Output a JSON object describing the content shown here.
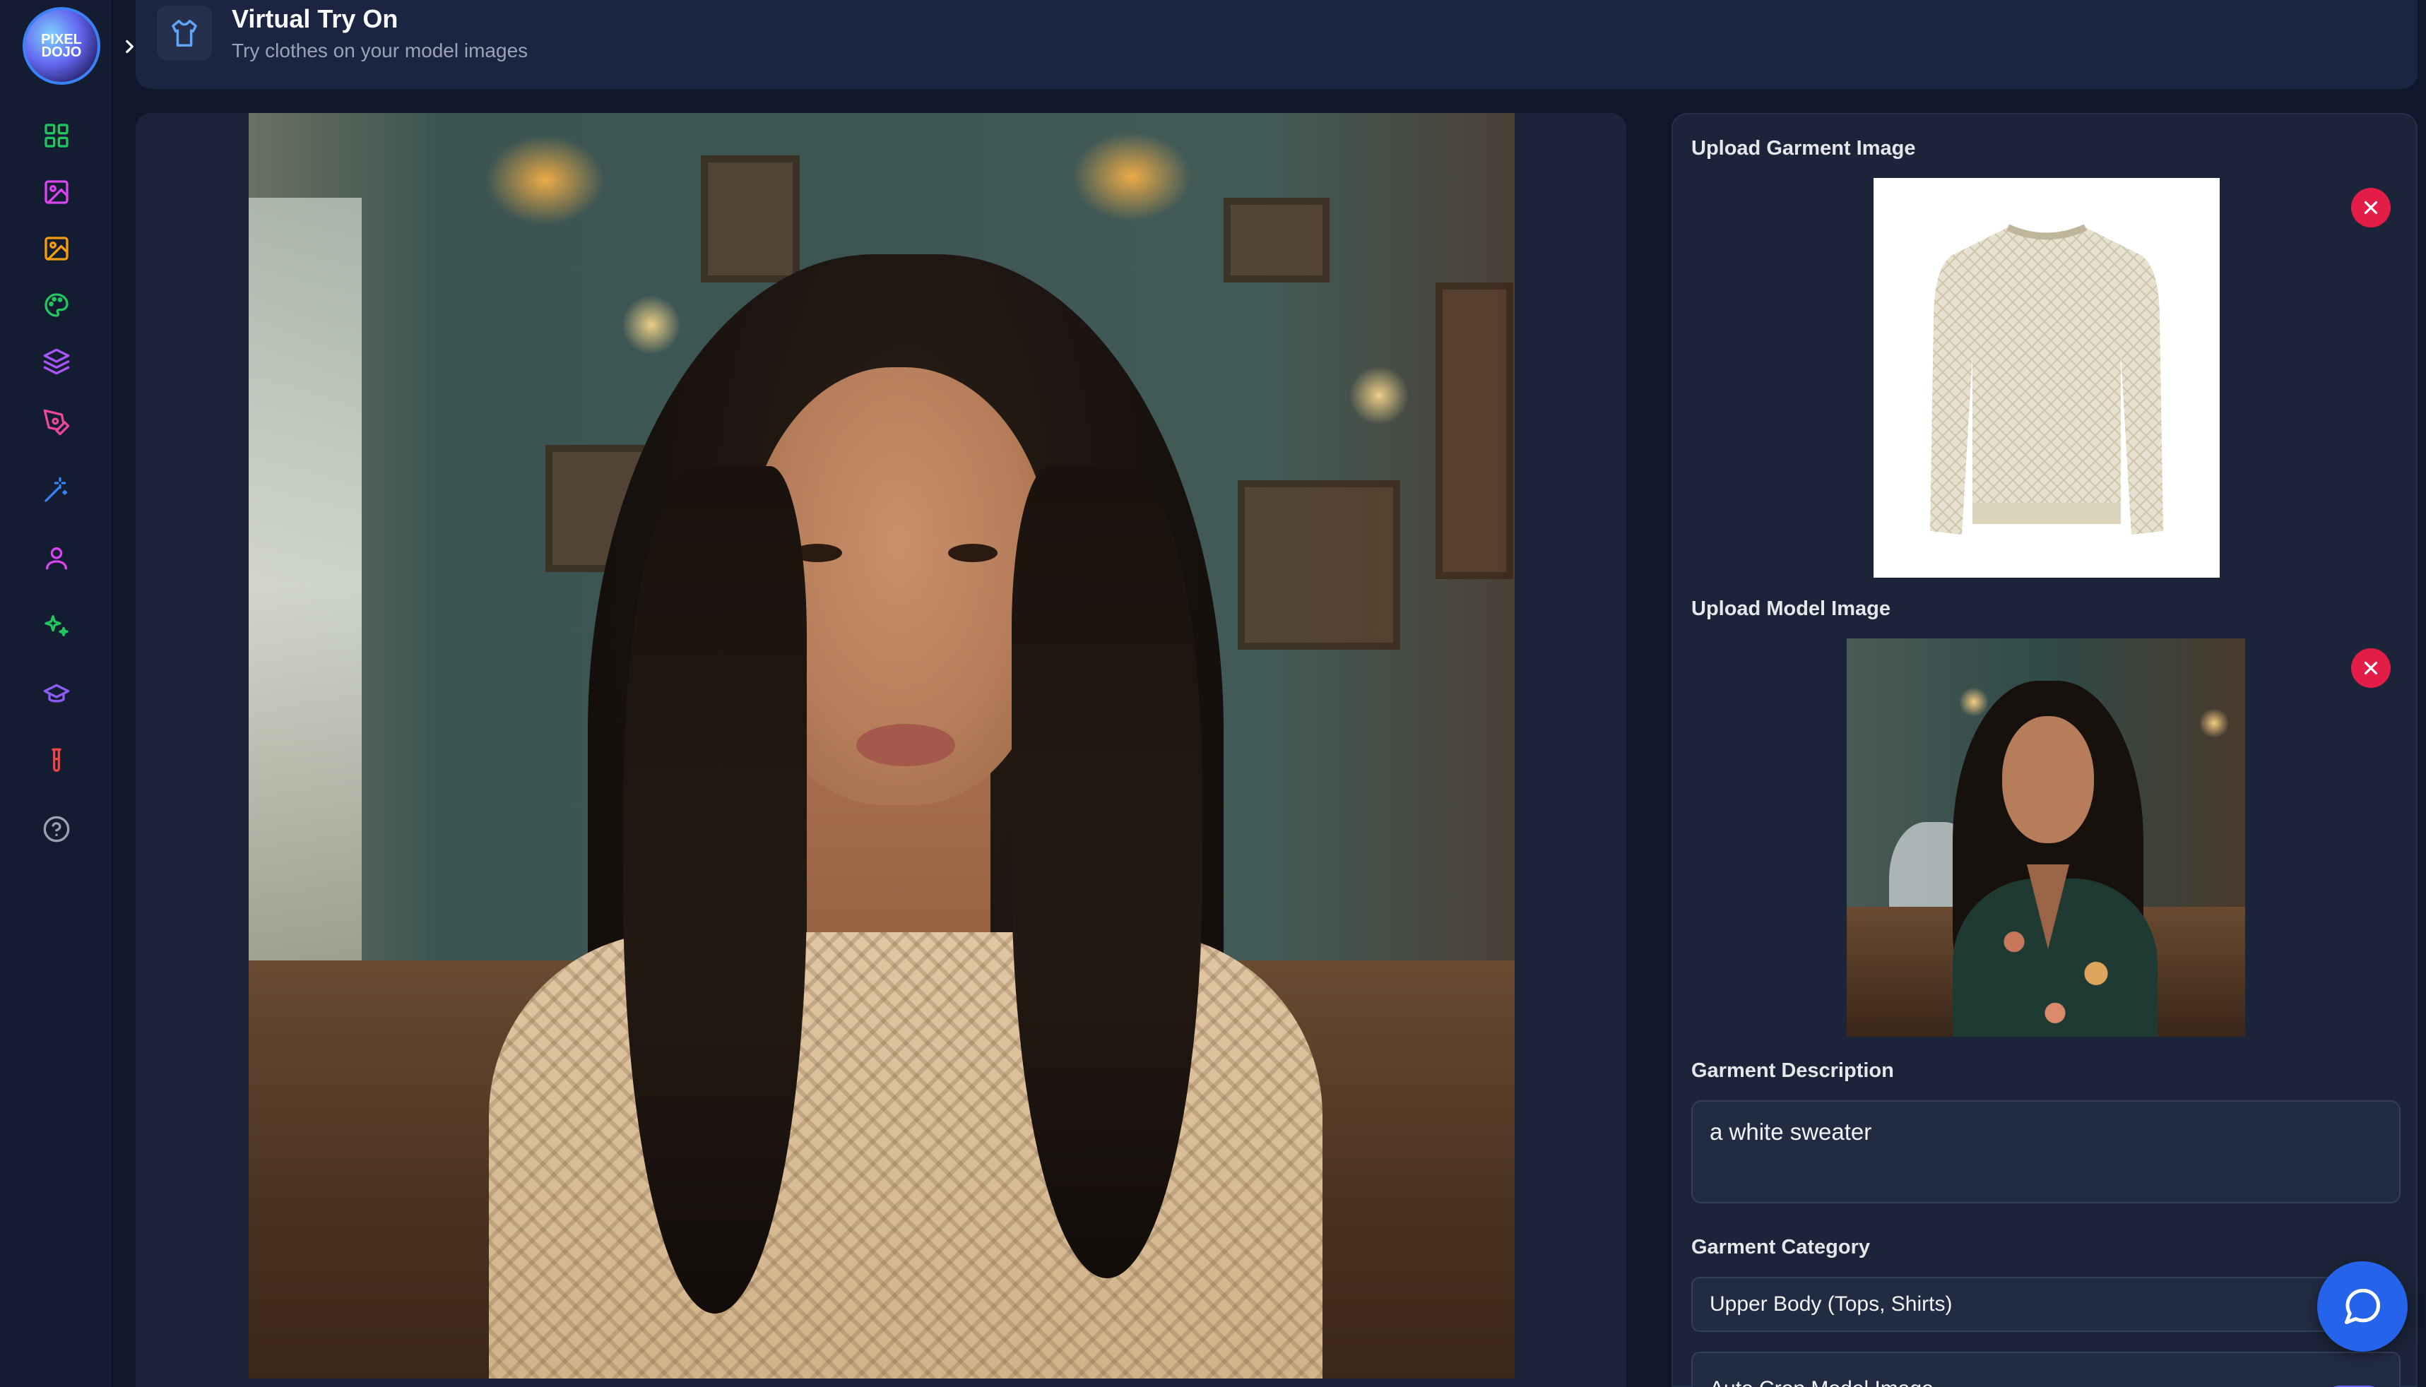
{
  "app": {
    "logo_text": "PIXEL DOJO"
  },
  "header": {
    "title": "Virtual Try On",
    "subtitle": "Try clothes on your model images",
    "icon": "shirt-icon"
  },
  "sidebar": {
    "items": [
      {
        "icon": "dashboard-grid-icon",
        "color": "#22c55e"
      },
      {
        "icon": "image-icon",
        "color": "#d946ef"
      },
      {
        "icon": "image-edit-icon",
        "color": "#f59e0b"
      },
      {
        "icon": "palette-icon",
        "color": "#22c55e"
      },
      {
        "icon": "layers-icon",
        "color": "#a855f7"
      },
      {
        "icon": "pen-tool-icon",
        "color": "#ec4899"
      },
      {
        "icon": "magic-wand-icon",
        "color": "#3b82f6"
      },
      {
        "icon": "user-icon",
        "color": "#d946ef"
      },
      {
        "icon": "sparkles-icon",
        "color": "#22c55e"
      },
      {
        "icon": "graduation-cap-icon",
        "color": "#8b5cf6"
      },
      {
        "icon": "test-tube-icon",
        "color": "#ef4444"
      },
      {
        "icon": "help-circle-icon",
        "color": "#9ca3af"
      }
    ]
  },
  "panel": {
    "garment_label": "Upload Garment Image",
    "model_label": "Upload Model Image",
    "description_label": "Garment Description",
    "description_value": "a white sweater",
    "category_label": "Garment Category",
    "category_value": "Upper Body (Tops, Shirts)",
    "auto_crop_label": "Auto Crop Model Image"
  },
  "colors": {
    "accent": "#6366f1",
    "remove": "#e11d48",
    "chat": "#2563eb"
  }
}
